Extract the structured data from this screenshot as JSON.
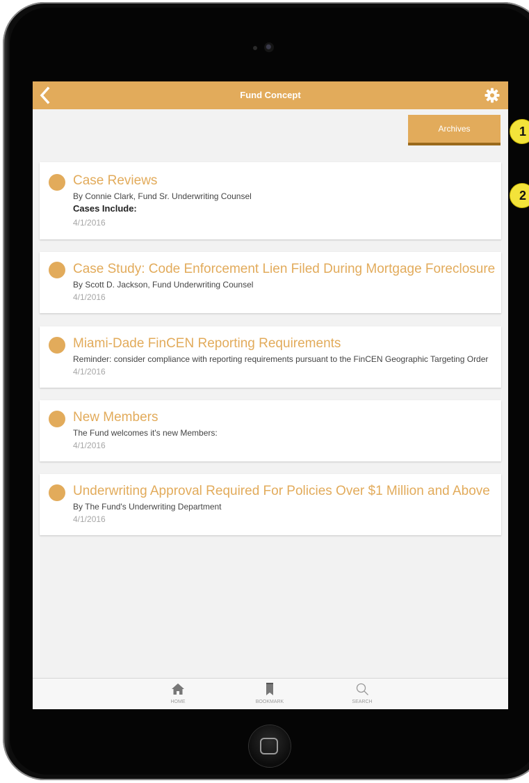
{
  "navbar": {
    "title": "Fund Concept",
    "back_icon": "chevron-left-icon",
    "settings_icon": "gear-icon"
  },
  "archives_label": "Archives",
  "callouts": [
    "1",
    "2"
  ],
  "items": [
    {
      "title": "Case Reviews",
      "subtitle": "By Connie Clark, Fund Sr. Underwriting Counsel",
      "bold": "Cases Include:",
      "date": "4/1/2016"
    },
    {
      "title": "Case Study: Code Enforcement Lien Filed During Mortgage Foreclosure",
      "subtitle": "By Scott D. Jackson, Fund Underwriting Counsel",
      "date": "4/1/2016"
    },
    {
      "title": "Miami-Dade FinCEN Reporting Requirements",
      "subtitle": "Reminder: consider compliance with reporting requirements pursuant to the FinCEN Geographic Targeting Order",
      "date": "4/1/2016"
    },
    {
      "title": "New Members",
      "subtitle": "The Fund welcomes it's new Members:",
      "date": "4/1/2016"
    },
    {
      "title": "Underwriting Approval Required For Policies Over $1 Million and Above",
      "subtitle": "By The Fund's Underwriting Department",
      "date": "4/1/2016"
    }
  ],
  "tabs": [
    {
      "label": "HOME",
      "icon": "home-icon"
    },
    {
      "label": "BOOKMARK",
      "icon": "bookmark-icon"
    },
    {
      "label": "SEARCH",
      "icon": "search-icon"
    }
  ],
  "colors": {
    "accent": "#e2ab5b",
    "accent_dark": "#9a6a1c",
    "background": "#f2f2f2",
    "callout": "#f3e33a"
  }
}
